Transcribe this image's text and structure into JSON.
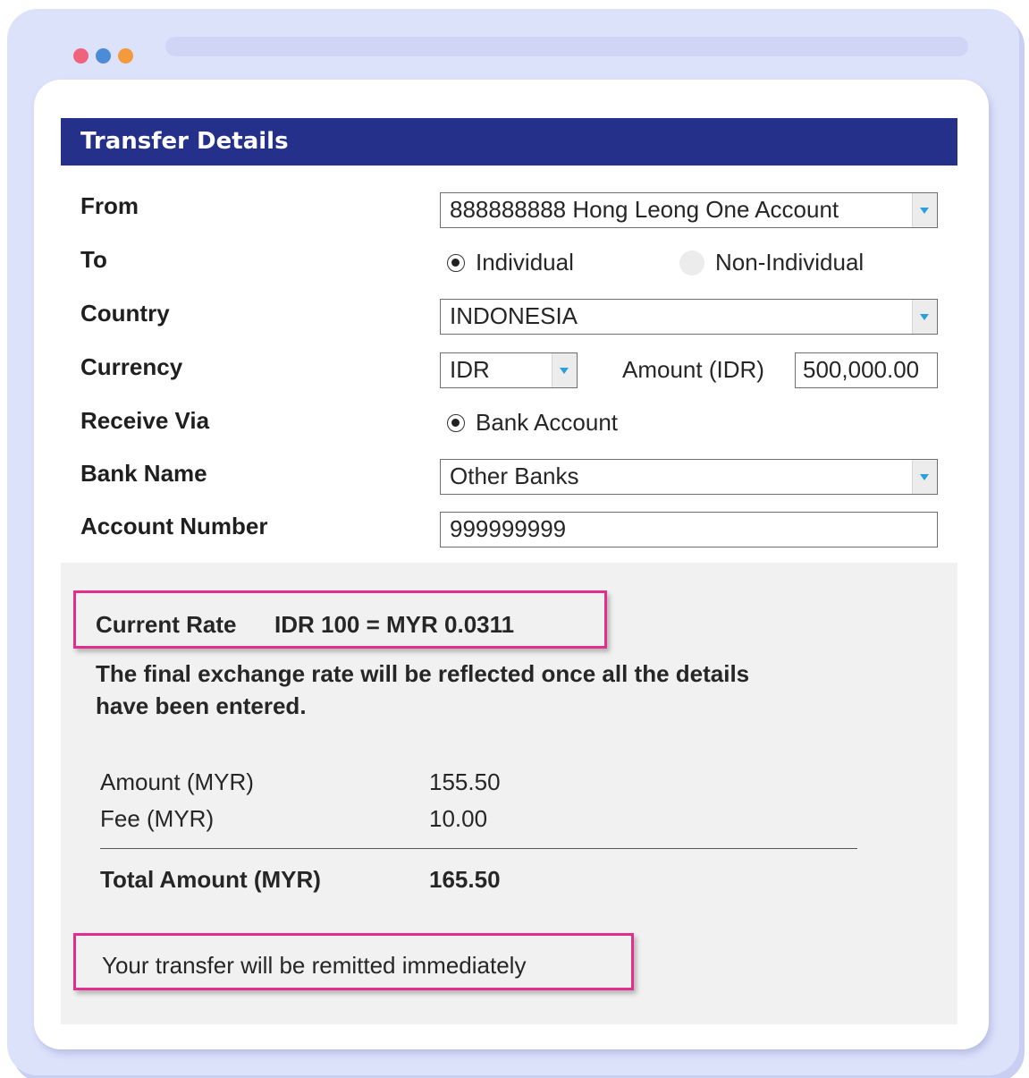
{
  "colors": {
    "window_bg": "#dde2fb",
    "header_bg": "#25308a",
    "highlight": "#e0308c",
    "dot_red": "#f0637c",
    "dot_blue": "#4c8bd7",
    "dot_orange": "#f29a3c"
  },
  "header": {
    "title": "Transfer Details"
  },
  "form": {
    "from": {
      "label": "From",
      "value": "888888888 Hong Leong One Account"
    },
    "to": {
      "label": "To",
      "option_individual": "Individual",
      "option_non_individual": "Non-Individual",
      "selected": "Individual"
    },
    "country": {
      "label": "Country",
      "value": "INDONESIA"
    },
    "currency": {
      "label": "Currency",
      "value": "IDR",
      "amount_label": "Amount (IDR)",
      "amount_value": "500,000.00"
    },
    "receive_via": {
      "label": "Receive Via",
      "option": "Bank Account"
    },
    "bank_name": {
      "label": "Bank Name",
      "value": "Other Banks"
    },
    "account_number": {
      "label": "Account Number",
      "value": "999999999"
    }
  },
  "summary": {
    "rate_label": "Current Rate",
    "rate_value": "IDR 100 = MYR 0.0311",
    "note_line1": "The final exchange rate will be reflected once all the details",
    "note_line2": "have been entered.",
    "amount_label": "Amount (MYR)",
    "amount_value": "155.50",
    "fee_label": "Fee (MYR)",
    "fee_value": "10.00",
    "total_label": "Total Amount (MYR)",
    "total_value": "165.50",
    "remit_message": "Your transfer will be remitted immediately"
  }
}
